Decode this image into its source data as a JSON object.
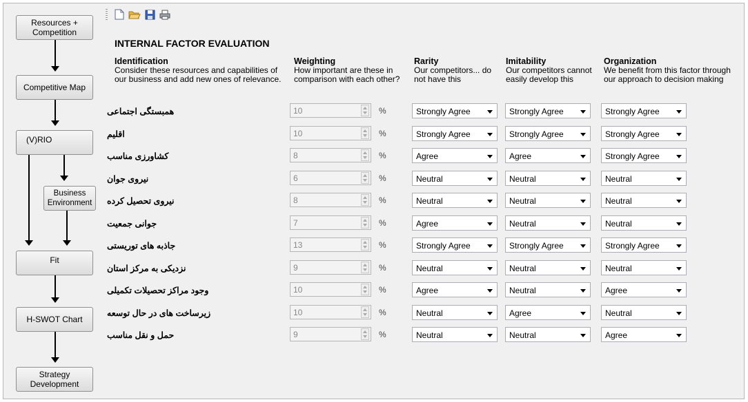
{
  "nav": {
    "resources": "Resources +\nCompetition",
    "competitive_map": "Competitive Map",
    "vrio": "(V)RIO",
    "business_env": "Business\nEnvironment",
    "fit": "Fit",
    "hswot": "H-SWOT Chart",
    "strategy": "Strategy\nDevelopment"
  },
  "toolbar": {
    "icons": [
      "new-icon",
      "open-icon",
      "save-icon",
      "print-icon"
    ]
  },
  "title": "INTERNAL FACTOR EVALUATION",
  "columns": {
    "identification": {
      "title": "Identification",
      "desc": "Consider these resources and capabilities of our business and add new ones of relevance."
    },
    "weighting": {
      "title": "Weighting",
      "desc": "How important are these in comparison with each other?"
    },
    "rarity": {
      "title": "Rarity",
      "desc": "Our competitors... do not have this"
    },
    "imitability": {
      "title": "Imitability",
      "desc": "Our competitors cannot easily develop this"
    },
    "organization": {
      "title": "Organization",
      "desc": "We benefit from this factor through our approach to decision making"
    }
  },
  "percent_symbol": "%",
  "rows": [
    {
      "label": "همبستگی اجتماعی",
      "weight": "10",
      "rarity": "Strongly Agree",
      "imitability": "Strongly Agree",
      "organization": "Strongly Agree"
    },
    {
      "label": "اقلیم",
      "weight": "10",
      "rarity": "Strongly Agree",
      "imitability": "Strongly Agree",
      "organization": "Strongly Agree"
    },
    {
      "label": "کشاورزی مناسب",
      "weight": "8",
      "rarity": "Agree",
      "imitability": "Agree",
      "organization": "Strongly Agree"
    },
    {
      "label": "نیروی جوان",
      "weight": "6",
      "rarity": "Neutral",
      "imitability": "Neutral",
      "organization": "Neutral"
    },
    {
      "label": "نیروی تحصیل کرده",
      "weight": "8",
      "rarity": "Neutral",
      "imitability": "Neutral",
      "organization": "Neutral"
    },
    {
      "label": "جوانی جمعیت",
      "weight": "7",
      "rarity": "Agree",
      "imitability": "Neutral",
      "organization": "Neutral"
    },
    {
      "label": "جاذبه های توریستی",
      "weight": "13",
      "rarity": "Strongly Agree",
      "imitability": "Strongly Agree",
      "organization": "Strongly Agree"
    },
    {
      "label": "نزدیکی به مرکز استان",
      "weight": "9",
      "rarity": "Neutral",
      "imitability": "Neutral",
      "organization": "Neutral"
    },
    {
      "label": "وجود مراکز تحصیلات تکمیلی",
      "weight": "10",
      "rarity": "Agree",
      "imitability": "Neutral",
      "organization": "Agree"
    },
    {
      "label": "زیرساخت های در حال توسعه",
      "weight": "10",
      "rarity": "Neutral",
      "imitability": "Agree",
      "organization": "Neutral"
    },
    {
      "label": "حمل و نقل مناسب",
      "weight": "9",
      "rarity": "Neutral",
      "imitability": "Neutral",
      "organization": "Agree"
    }
  ]
}
